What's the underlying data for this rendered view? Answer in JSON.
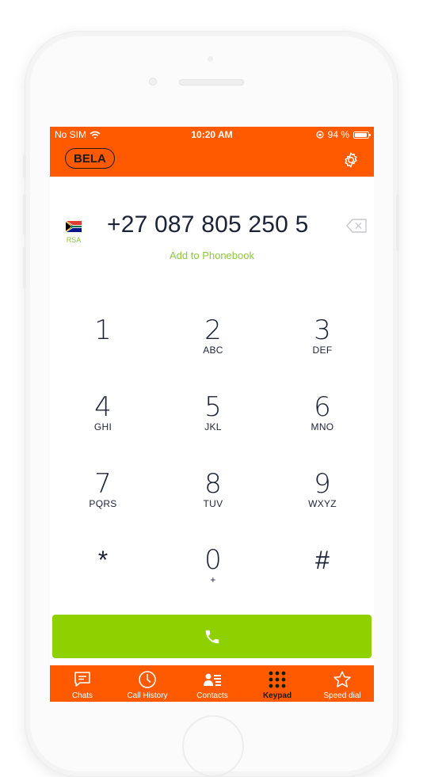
{
  "status_bar": {
    "carrier": "No SIM",
    "time": "10:20 AM",
    "battery_percent": "94 %",
    "battery_level": 0.94
  },
  "header": {
    "brand": "BELA"
  },
  "dialer": {
    "country_code": "RSA",
    "number": "+27 087 805 250 5",
    "add_to_phonebook": "Add to Phonebook"
  },
  "keypad": {
    "keys": [
      {
        "digit": "1",
        "letters": ""
      },
      {
        "digit": "2",
        "letters": "ABC"
      },
      {
        "digit": "3",
        "letters": "DEF"
      },
      {
        "digit": "4",
        "letters": "GHI"
      },
      {
        "digit": "5",
        "letters": "JKL"
      },
      {
        "digit": "6",
        "letters": "MNO"
      },
      {
        "digit": "7",
        "letters": "PQRS"
      },
      {
        "digit": "8",
        "letters": "TUV"
      },
      {
        "digit": "9",
        "letters": "WXYZ"
      },
      {
        "digit": "*",
        "letters": ""
      },
      {
        "digit": "0",
        "letters": "+"
      },
      {
        "digit": "#",
        "letters": ""
      }
    ]
  },
  "tabs": [
    {
      "label": "Chats",
      "icon": "chat-icon"
    },
    {
      "label": "Call History",
      "icon": "clock-icon"
    },
    {
      "label": "Contacts",
      "icon": "contact-card-icon"
    },
    {
      "label": "Keypad",
      "icon": "keypad-icon",
      "active": true
    },
    {
      "label": "Speed dial",
      "icon": "star-icon"
    }
  ],
  "colors": {
    "brand_orange": "#ff5a00",
    "call_green": "#8fd000",
    "link_green": "#8dc63f",
    "text_dark": "#1d2337"
  }
}
